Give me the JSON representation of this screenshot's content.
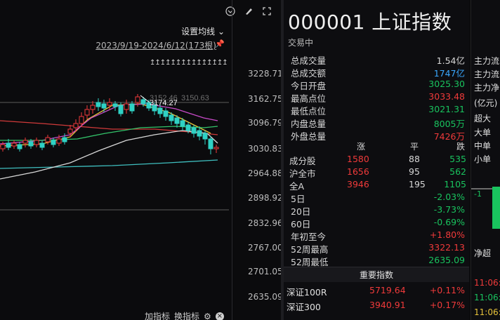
{
  "chart": {
    "ma_button": "设置均线",
    "range_text": "2023/9/19-2024/6/12(173根)",
    "high_label": "3174.27",
    "ghost_labels": [
      "3152.46",
      "3150.63"
    ],
    "ticks_deco": "↥↥↥↥↥↥↥↥↥↥↥↥↥↥↥",
    "y_labels": [
      "3228.71",
      "3162.75",
      "3096.79",
      "3030.83",
      "2964.88",
      "2898.92",
      "2832.96",
      "2767.00",
      "2701.05",
      "2635.09"
    ],
    "bottom_links": [
      "加指标",
      "换指标"
    ]
  },
  "quote": {
    "code": "000001",
    "name": "上证指数",
    "status": "交易中",
    "stats": [
      {
        "k": "总成交量",
        "v": "1.54亿",
        "c": "flat"
      },
      {
        "k": "总成交额",
        "v": "1747亿",
        "c": "cyan"
      },
      {
        "k": "今日开盘",
        "v": "3025.30",
        "c": "down"
      },
      {
        "k": "最高点位",
        "v": "3033.48",
        "c": "up"
      },
      {
        "k": "最低点位",
        "v": "3021.31",
        "c": "down"
      },
      {
        "k": "内盘总量",
        "v": "8005万",
        "c": "down"
      },
      {
        "k": "外盘总量",
        "v": "7426万",
        "c": "up"
      }
    ],
    "breadth_head": {
      "rise": "涨",
      "flat": "平",
      "fall": "跌"
    },
    "breadth": [
      {
        "name": "成分股",
        "rise": "1580",
        "flat": "88",
        "fall": "535"
      },
      {
        "name": "沪全市",
        "rise": "1656",
        "flat": "95",
        "fall": "562"
      },
      {
        "name": "全A",
        "rise": "3946",
        "flat": "195",
        "fall": "1105"
      }
    ],
    "periods": [
      {
        "k": "5日",
        "v": "-2.03%",
        "c": "down"
      },
      {
        "k": "20日",
        "v": "-3.73%",
        "c": "down"
      },
      {
        "k": "60日",
        "v": "-0.69%",
        "c": "down"
      },
      {
        "k": "年初至今",
        "v": "+1.80%",
        "c": "up"
      },
      {
        "k": "52周最高",
        "v": "3322.13",
        "c": "up"
      },
      {
        "k": "52周最低",
        "v": "2635.09",
        "c": "down"
      }
    ],
    "indices_title": "重要指数",
    "indices": [
      {
        "name": "深证100R",
        "price": "5719.64",
        "chg": "+0.11%",
        "c": "up"
      },
      {
        "name": "深证300",
        "price": "3940.91",
        "chg": "+0.17%",
        "c": "up"
      }
    ]
  },
  "flow": {
    "labels": [
      "主力流",
      "主力流",
      "主力净",
      "(亿元)",
      "超大",
      "大单",
      "中单",
      "小单"
    ],
    "bar_label": "-1",
    "net_label": "净超",
    "times": [
      "11:06:",
      "11:06:",
      "11:06:"
    ]
  },
  "colors": {
    "up": "#f03a3a",
    "down": "#19c35e",
    "cyan": "#3aa8ff",
    "bg": "#0b0b0d"
  }
}
